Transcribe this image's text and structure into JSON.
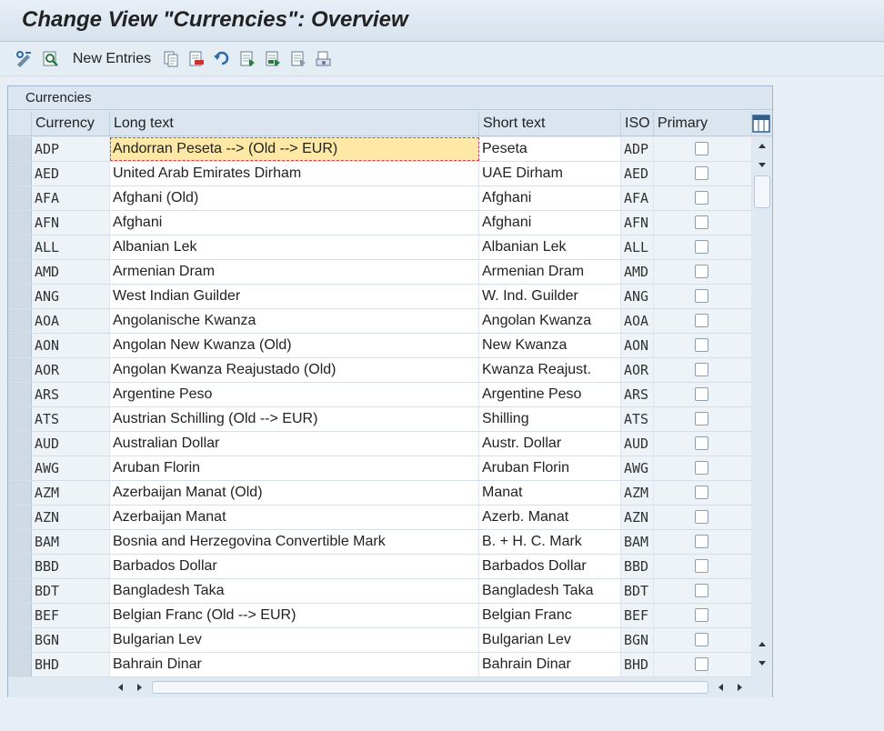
{
  "title": "Change View \"Currencies\": Overview",
  "toolbar": {
    "new_entries_label": "New Entries",
    "icons": [
      "display-change-icon",
      "find-icon",
      "copy-icon",
      "delete-icon",
      "undo-icon",
      "select-all-icon",
      "select-block-icon",
      "deselect-all-icon",
      "print-icon"
    ]
  },
  "panel": {
    "title": "Currencies",
    "columns": {
      "currency": "Currency",
      "long": "Long text",
      "short": "Short text",
      "iso": "ISO",
      "primary": "Primary"
    }
  },
  "rows": [
    {
      "code": "ADP",
      "long": "Andorran Peseta --> (Old --> EUR)",
      "short": "Peseta",
      "iso": "ADP",
      "primary": false
    },
    {
      "code": "AED",
      "long": "United Arab Emirates Dirham",
      "short": "UAE Dirham",
      "iso": "AED",
      "primary": false
    },
    {
      "code": "AFA",
      "long": "Afghani (Old)",
      "short": "Afghani",
      "iso": "AFA",
      "primary": false
    },
    {
      "code": "AFN",
      "long": "Afghani",
      "short": "Afghani",
      "iso": "AFN",
      "primary": false
    },
    {
      "code": "ALL",
      "long": "Albanian Lek",
      "short": "Albanian Lek",
      "iso": "ALL",
      "primary": false
    },
    {
      "code": "AMD",
      "long": "Armenian Dram",
      "short": "Armenian Dram",
      "iso": "AMD",
      "primary": false
    },
    {
      "code": "ANG",
      "long": "West Indian Guilder",
      "short": "W. Ind. Guilder",
      "iso": "ANG",
      "primary": false
    },
    {
      "code": "AOA",
      "long": "Angolanische Kwanza",
      "short": "Angolan Kwanza",
      "iso": "AOA",
      "primary": false
    },
    {
      "code": "AON",
      "long": "Angolan New Kwanza (Old)",
      "short": "New Kwanza",
      "iso": "AON",
      "primary": false
    },
    {
      "code": "AOR",
      "long": "Angolan Kwanza Reajustado (Old)",
      "short": "Kwanza Reajust.",
      "iso": "AOR",
      "primary": false
    },
    {
      "code": "ARS",
      "long": "Argentine Peso",
      "short": "Argentine Peso",
      "iso": "ARS",
      "primary": false
    },
    {
      "code": "ATS",
      "long": "Austrian Schilling (Old --> EUR)",
      "short": "Shilling",
      "iso": "ATS",
      "primary": false
    },
    {
      "code": "AUD",
      "long": "Australian Dollar",
      "short": "Austr. Dollar",
      "iso": "AUD",
      "primary": false
    },
    {
      "code": "AWG",
      "long": "Aruban Florin",
      "short": "Aruban Florin",
      "iso": "AWG",
      "primary": false
    },
    {
      "code": "AZM",
      "long": "Azerbaijan Manat (Old)",
      "short": "Manat",
      "iso": "AZM",
      "primary": false
    },
    {
      "code": "AZN",
      "long": "Azerbaijan Manat",
      "short": "Azerb. Manat",
      "iso": "AZN",
      "primary": false
    },
    {
      "code": "BAM",
      "long": "Bosnia and Herzegovina Convertible Mark",
      "short": "B. + H. C. Mark",
      "iso": "BAM",
      "primary": false
    },
    {
      "code": "BBD",
      "long": "Barbados Dollar",
      "short": "Barbados Dollar",
      "iso": "BBD",
      "primary": false
    },
    {
      "code": "BDT",
      "long": "Bangladesh Taka",
      "short": "Bangladesh Taka",
      "iso": "BDT",
      "primary": false
    },
    {
      "code": "BEF",
      "long": "Belgian Franc (Old --> EUR)",
      "short": "Belgian Franc",
      "iso": "BEF",
      "primary": false
    },
    {
      "code": "BGN",
      "long": "Bulgarian Lev",
      "short": "Bulgarian Lev",
      "iso": "BGN",
      "primary": false
    },
    {
      "code": "BHD",
      "long": "Bahrain Dinar",
      "short": "Bahrain Dinar",
      "iso": "BHD",
      "primary": false
    }
  ],
  "colors": {
    "focus_cell": "#fde9a5",
    "header_bg": "#dae5ef"
  }
}
